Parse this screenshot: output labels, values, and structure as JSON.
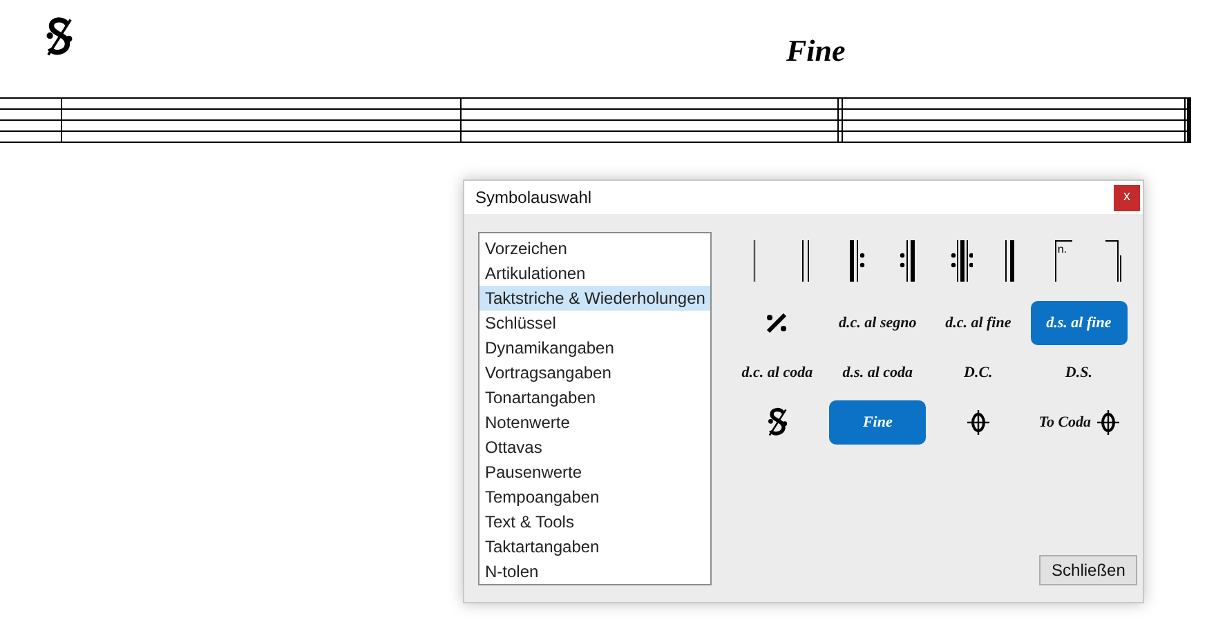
{
  "score": {
    "marking": "Fine"
  },
  "dialog": {
    "title": "Symbolauswahl",
    "close": "x",
    "categories": [
      {
        "label": "Vorzeichen",
        "selected": false
      },
      {
        "label": "Artikulationen",
        "selected": false
      },
      {
        "label": "Taktstriche & Wiederholungen",
        "selected": true
      },
      {
        "label": "Schlüssel",
        "selected": false
      },
      {
        "label": "Dynamikangaben",
        "selected": false
      },
      {
        "label": "Vortragsangaben",
        "selected": false
      },
      {
        "label": "Tonartangaben",
        "selected": false
      },
      {
        "label": "Notenwerte",
        "selected": false
      },
      {
        "label": "Ottavas",
        "selected": false
      },
      {
        "label": "Pausenwerte",
        "selected": false
      },
      {
        "label": "Tempoangaben",
        "selected": false
      },
      {
        "label": "Text & Tools",
        "selected": false
      },
      {
        "label": "Taktartangaben",
        "selected": false
      },
      {
        "label": "N-tolen",
        "selected": false
      }
    ],
    "barlines": [
      {
        "kind": "single"
      },
      {
        "kind": "double"
      },
      {
        "kind": "repeat_start"
      },
      {
        "kind": "repeat_end"
      },
      {
        "kind": "repeat_both"
      },
      {
        "kind": "final"
      },
      {
        "kind": "volta_start",
        "label": "n."
      },
      {
        "kind": "volta_end"
      }
    ],
    "symbols": [
      {
        "kind": "simile",
        "selected": false
      },
      {
        "kind": "text",
        "label": "d.c. al segno",
        "selected": false
      },
      {
        "kind": "text",
        "label": "d.c. al fine",
        "selected": false
      },
      {
        "kind": "text",
        "label": "d.s. al fine",
        "selected": true
      },
      {
        "kind": "text",
        "label": "d.c. al coda",
        "selected": false
      },
      {
        "kind": "text",
        "label": "d.s. al coda",
        "selected": false
      },
      {
        "kind": "text",
        "label": "D.C.",
        "selected": false
      },
      {
        "kind": "text",
        "label": "D.S.",
        "selected": false
      },
      {
        "kind": "segno",
        "selected": false
      },
      {
        "kind": "text",
        "label": "Fine",
        "selected": true
      },
      {
        "kind": "coda",
        "selected": false
      },
      {
        "kind": "tocoda",
        "label": "To Coda",
        "selected": false
      }
    ],
    "close_button": "Schließen"
  }
}
